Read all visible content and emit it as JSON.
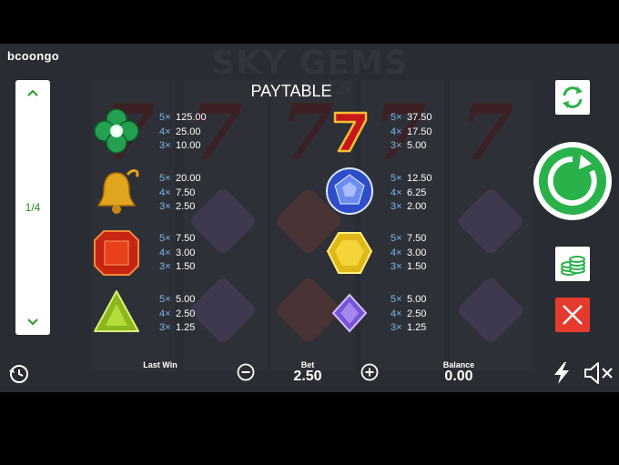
{
  "brand": "bcoongo",
  "background_logo": {
    "title": "SKY GEMS",
    "subtitle": "BONUS"
  },
  "title": "PAYTABLE",
  "pager": {
    "page": "1/4"
  },
  "paytable": [
    {
      "symbol": "clover-emerald",
      "pays": [
        {
          "count": "5×",
          "amount": "125.00"
        },
        {
          "count": "4×",
          "amount": "25.00"
        },
        {
          "count": "3×",
          "amount": "10.00"
        }
      ]
    },
    {
      "symbol": "red-seven",
      "pays": [
        {
          "count": "5×",
          "amount": "37.50"
        },
        {
          "count": "4×",
          "amount": "17.50"
        },
        {
          "count": "3×",
          "amount": "5.00"
        }
      ]
    },
    {
      "symbol": "golden-bell",
      "pays": [
        {
          "count": "5×",
          "amount": "20.00"
        },
        {
          "count": "4×",
          "amount": "7.50"
        },
        {
          "count": "3×",
          "amount": "2.50"
        }
      ]
    },
    {
      "symbol": "blue-round-gem",
      "pays": [
        {
          "count": "5×",
          "amount": "12.50"
        },
        {
          "count": "4×",
          "amount": "6.25"
        },
        {
          "count": "3×",
          "amount": "2.00"
        }
      ]
    },
    {
      "symbol": "red-square-gem",
      "pays": [
        {
          "count": "5×",
          "amount": "7.50"
        },
        {
          "count": "4×",
          "amount": "3.00"
        },
        {
          "count": "3×",
          "amount": "1.50"
        }
      ]
    },
    {
      "symbol": "yellow-hexagon-gem",
      "pays": [
        {
          "count": "5×",
          "amount": "7.50"
        },
        {
          "count": "4×",
          "amount": "3.00"
        },
        {
          "count": "3×",
          "amount": "1.50"
        }
      ]
    },
    {
      "symbol": "green-triangle-gem",
      "pays": [
        {
          "count": "5×",
          "amount": "5.00"
        },
        {
          "count": "4×",
          "amount": "2.50"
        },
        {
          "count": "3×",
          "amount": "1.25"
        }
      ]
    },
    {
      "symbol": "purple-diamond-gem",
      "pays": [
        {
          "count": "5×",
          "amount": "5.00"
        },
        {
          "count": "4×",
          "amount": "2.50"
        },
        {
          "count": "3×",
          "amount": "1.25"
        }
      ]
    }
  ],
  "footer": {
    "last_win_label": "Last Win",
    "last_win_value": "",
    "bet_label": "Bet",
    "bet_value": "2.50",
    "balance_label": "Balance",
    "balance_value": "0.00"
  },
  "colors": {
    "accent_green": "#2ab24a",
    "close_red": "#e53a2e",
    "pay_multiplier_blue": "#79b8ee"
  },
  "icons": [
    "history-clock-icon",
    "minus-circle-icon",
    "plus-circle-icon",
    "lightning-icon",
    "mute-speaker-icon",
    "autoplay-arrows-icon",
    "spin-icon",
    "coins-icon",
    "close-icon",
    "chevron-up-icon",
    "chevron-down-icon"
  ]
}
